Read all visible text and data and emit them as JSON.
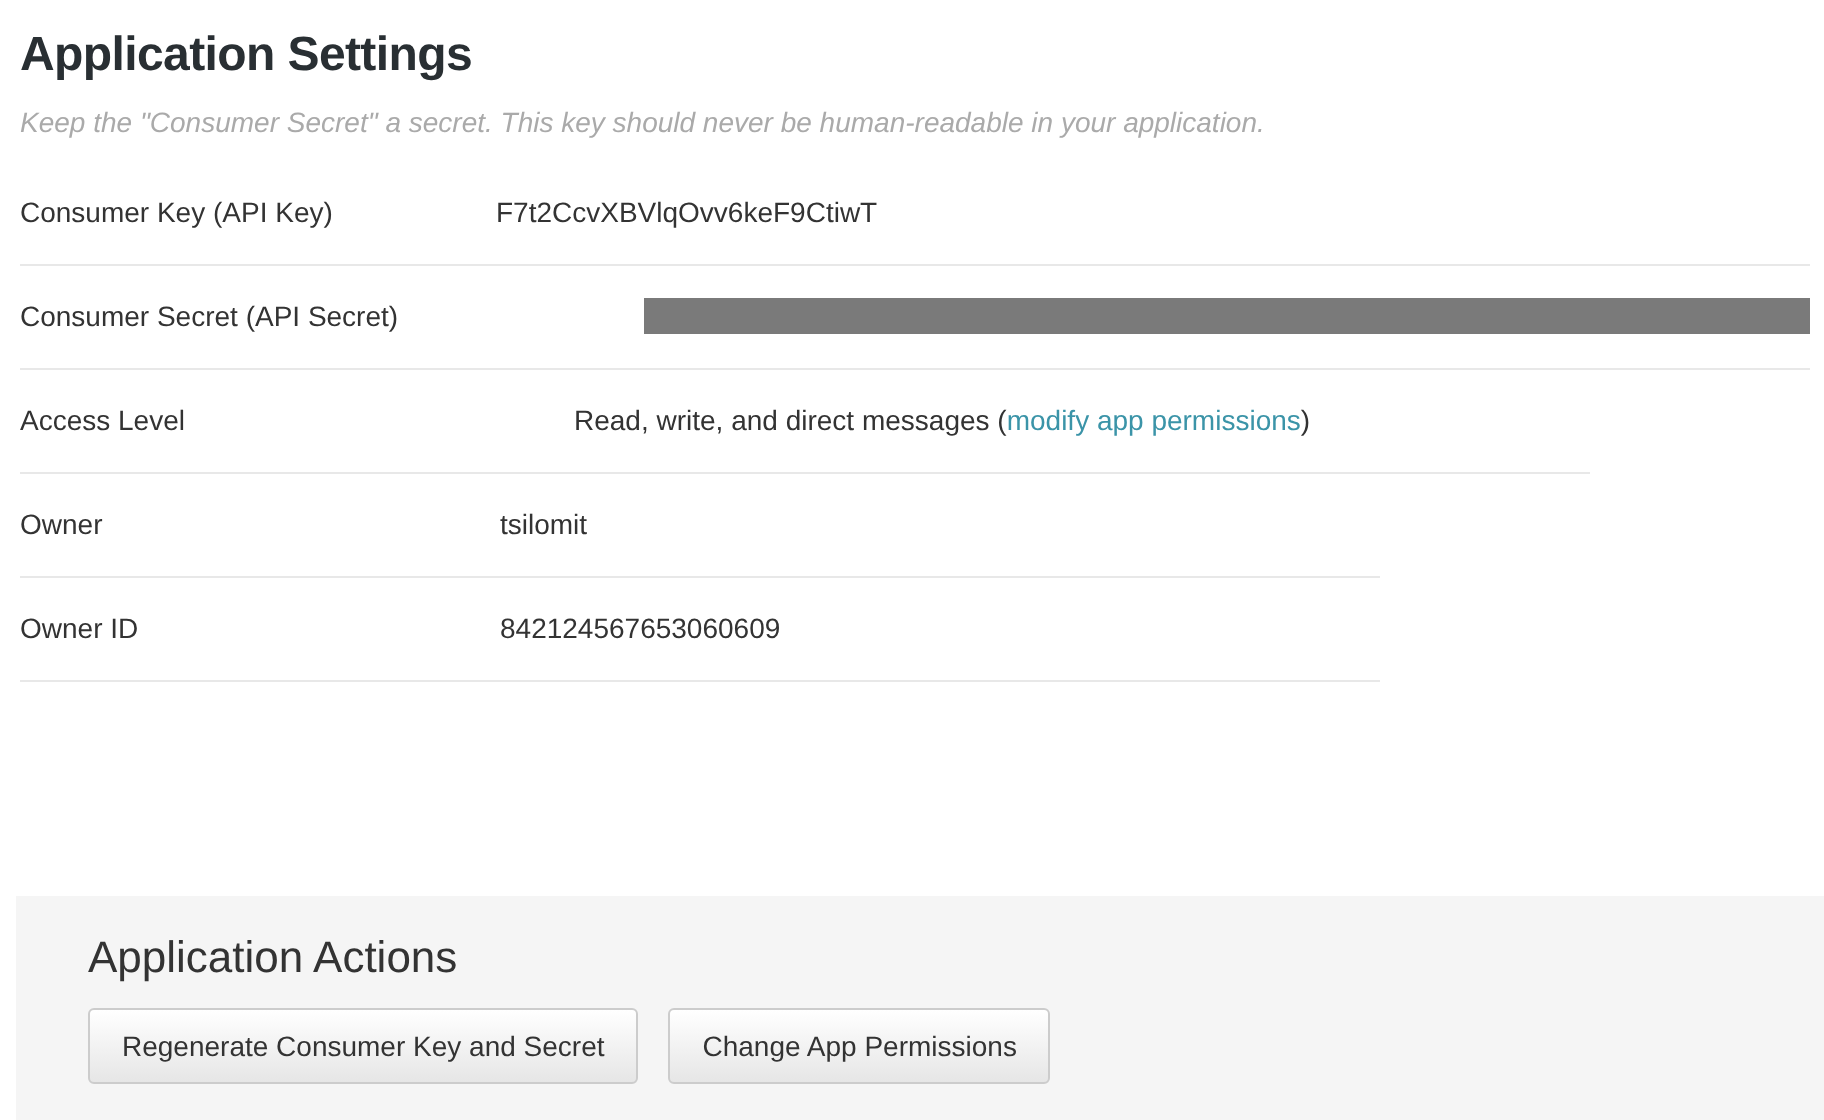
{
  "title": "Application Settings",
  "note": "Keep the \"Consumer Secret\" a secret. This key should never be human-readable in your application.",
  "rows": [
    {
      "label": "Consumer Key (API Key)",
      "kind": "text",
      "value": "F7t2CcvXBVlqOvv6keF9CtiwT"
    },
    {
      "label": "Consumer Secret (API Secret)",
      "kind": "redacted"
    },
    {
      "label": "Access Level",
      "kind": "link_text",
      "value": "Read, write, and direct messages (",
      "link": "modify app permissions",
      "suffix": ")"
    },
    {
      "label": "Owner",
      "kind": "text",
      "value": "tsilomit"
    },
    {
      "label": "Owner ID",
      "kind": "text",
      "value": "842124567653060609"
    }
  ],
  "actions": {
    "title": "Application Actions",
    "buttons": [
      "Regenerate Consumer Key and Secret",
      "Change App Permissions"
    ]
  }
}
